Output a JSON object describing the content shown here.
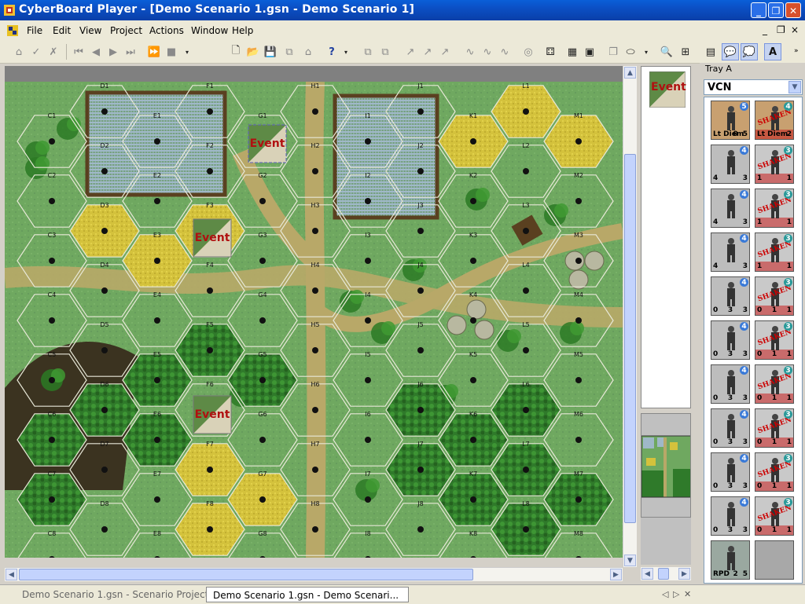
{
  "window": {
    "title": "CyberBoard Player - [Demo Scenario 1.gsn - Demo Scenario 1]",
    "minimize_glyph": "_",
    "maximize_glyph": "❐",
    "close_glyph": "✕"
  },
  "menu": {
    "items": [
      "File",
      "Edit",
      "View",
      "Project",
      "Actions",
      "Window",
      "Help"
    ],
    "mdi_minimize": "_",
    "mdi_restore": "❐",
    "mdi_close": "×"
  },
  "toolbar": {
    "icons": [
      "move-icon",
      "plot-icon",
      "plot-discard-icon",
      "first-icon",
      "prev-icon",
      "next-icon",
      "last-icon",
      "play-icon",
      "stop-icon",
      "what-icon",
      "new-icon",
      "open-icon",
      "save-icon",
      "copy-icon",
      "send-icon",
      "arrow-icon",
      "grid-icon",
      "rotate-icon",
      "layer-icon",
      "zoom-icon",
      "tile-icon"
    ],
    "text_tool_glyph": "A"
  },
  "map": {
    "event_label": "Event",
    "columns": [
      "C",
      "D",
      "E",
      "F",
      "G",
      "H",
      "I",
      "J",
      "K",
      "L",
      "M"
    ],
    "rows": [
      "1",
      "2",
      "3",
      "4",
      "5",
      "6",
      "7",
      "8"
    ]
  },
  "preview": {
    "event_label": "Event"
  },
  "tray": {
    "title": "Tray A",
    "selected": "VCN",
    "pieces": [
      {
        "front_label": "Lt Diem",
        "front_badge": "5",
        "front_stats": [
          "0",
          "5"
        ],
        "back_label": "Lt Diem",
        "back_badge": "4",
        "back_stats": [
          "2"
        ]
      },
      {
        "front_badge": "4",
        "front_stats": [
          "4",
          "3"
        ],
        "back_badge": "3",
        "back_stats": [
          "1",
          "1"
        ]
      },
      {
        "front_badge": "4",
        "front_stats": [
          "4",
          "3"
        ],
        "back_badge": "3",
        "back_stats": [
          "1",
          "1"
        ]
      },
      {
        "front_badge": "4",
        "front_stats": [
          "4",
          "3"
        ],
        "back_badge": "3",
        "back_stats": [
          "1",
          "1"
        ]
      },
      {
        "front_badge": "4",
        "front_stats": [
          "0",
          "3",
          "3"
        ],
        "back_badge": "3",
        "back_stats": [
          "0",
          "1",
          "1"
        ]
      },
      {
        "front_badge": "4",
        "front_stats": [
          "0",
          "3",
          "3"
        ],
        "back_badge": "3",
        "back_stats": [
          "0",
          "1",
          "1"
        ]
      },
      {
        "front_badge": "4",
        "front_stats": [
          "0",
          "3",
          "3"
        ],
        "back_badge": "3",
        "back_stats": [
          "0",
          "1",
          "1"
        ]
      },
      {
        "front_badge": "4",
        "front_stats": [
          "0",
          "3",
          "3"
        ],
        "back_badge": "3",
        "back_stats": [
          "0",
          "1",
          "1"
        ]
      },
      {
        "front_badge": "4",
        "front_stats": [
          "0",
          "3",
          "3"
        ],
        "back_badge": "3",
        "back_stats": [
          "0",
          "1",
          "1"
        ]
      },
      {
        "front_badge": "4",
        "front_stats": [
          "0",
          "3",
          "3"
        ],
        "back_badge": "3",
        "back_stats": [
          "0",
          "1",
          "1"
        ]
      },
      {
        "front_label": "RPD",
        "front_stats": [
          "2",
          "5"
        ]
      }
    ],
    "shaken_label": "SHAKEN"
  },
  "tabs": [
    {
      "label": "Demo Scenario 1.gsn - Scenario Project",
      "active": false
    },
    {
      "label": "Demo Scenario 1.gsn - Demo Scenari...",
      "active": true
    }
  ],
  "tab_controls": [
    "◁",
    "▷",
    "✕"
  ],
  "colors": {
    "titlebar": "#0b4fc4",
    "grass": "#6fa860",
    "field_yellow": "#d8c840",
    "road": "#b8a868",
    "forest": "#2f7a2a",
    "event_red": "#b01010"
  }
}
